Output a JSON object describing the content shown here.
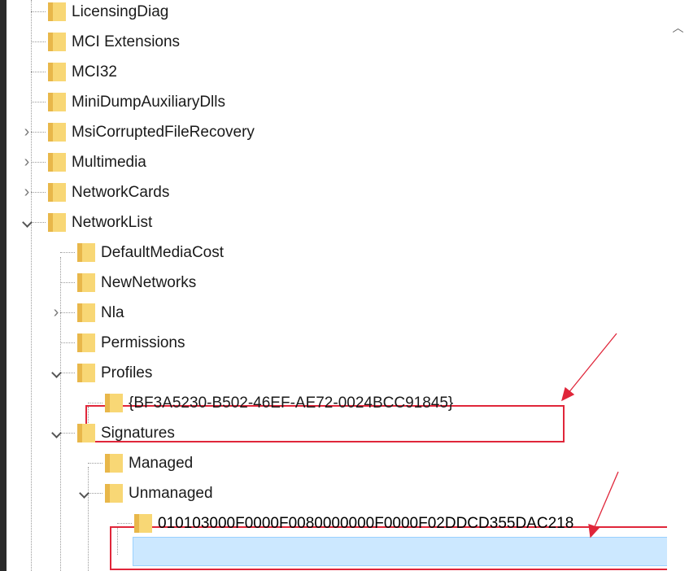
{
  "tree": {
    "items": [
      {
        "label": "LicensingDiag",
        "level": 0,
        "state": "leaf"
      },
      {
        "label": "MCI Extensions",
        "level": 0,
        "state": "leaf"
      },
      {
        "label": "MCI32",
        "level": 0,
        "state": "leaf"
      },
      {
        "label": "MiniDumpAuxiliaryDlls",
        "level": 0,
        "state": "leaf"
      },
      {
        "label": "MsiCorruptedFileRecovery",
        "level": 0,
        "state": "collapsed"
      },
      {
        "label": "Multimedia",
        "level": 0,
        "state": "collapsed"
      },
      {
        "label": "NetworkCards",
        "level": 0,
        "state": "collapsed"
      },
      {
        "label": "NetworkList",
        "level": 0,
        "state": "expanded"
      },
      {
        "label": "DefaultMediaCost",
        "level": 1,
        "state": "leaf"
      },
      {
        "label": "NewNetworks",
        "level": 1,
        "state": "leaf"
      },
      {
        "label": "Nla",
        "level": 1,
        "state": "collapsed"
      },
      {
        "label": "Permissions",
        "level": 1,
        "state": "leaf"
      },
      {
        "label": "Profiles",
        "level": 1,
        "state": "expanded"
      },
      {
        "label": "{BF3A5230-B502-46EF-AE72-0024BCC91845}",
        "level": 2,
        "state": "leaf"
      },
      {
        "label": "Signatures",
        "level": 1,
        "state": "expanded"
      },
      {
        "label": "Managed",
        "level": 2,
        "state": "leaf"
      },
      {
        "label": "Unmanaged",
        "level": 2,
        "state": "expanded"
      },
      {
        "label": "010103000F0000F0080000000F0000F02DDCD355DAC218",
        "level": 3,
        "state": "leaf",
        "selected": true
      }
    ]
  },
  "colors": {
    "folder_light": "#f8d775",
    "folder_dark": "#e8b74a",
    "selection": "#cce8ff",
    "annotation": "#e0263a"
  },
  "scrollbar": {
    "up_icon": "chevron-up-icon"
  }
}
